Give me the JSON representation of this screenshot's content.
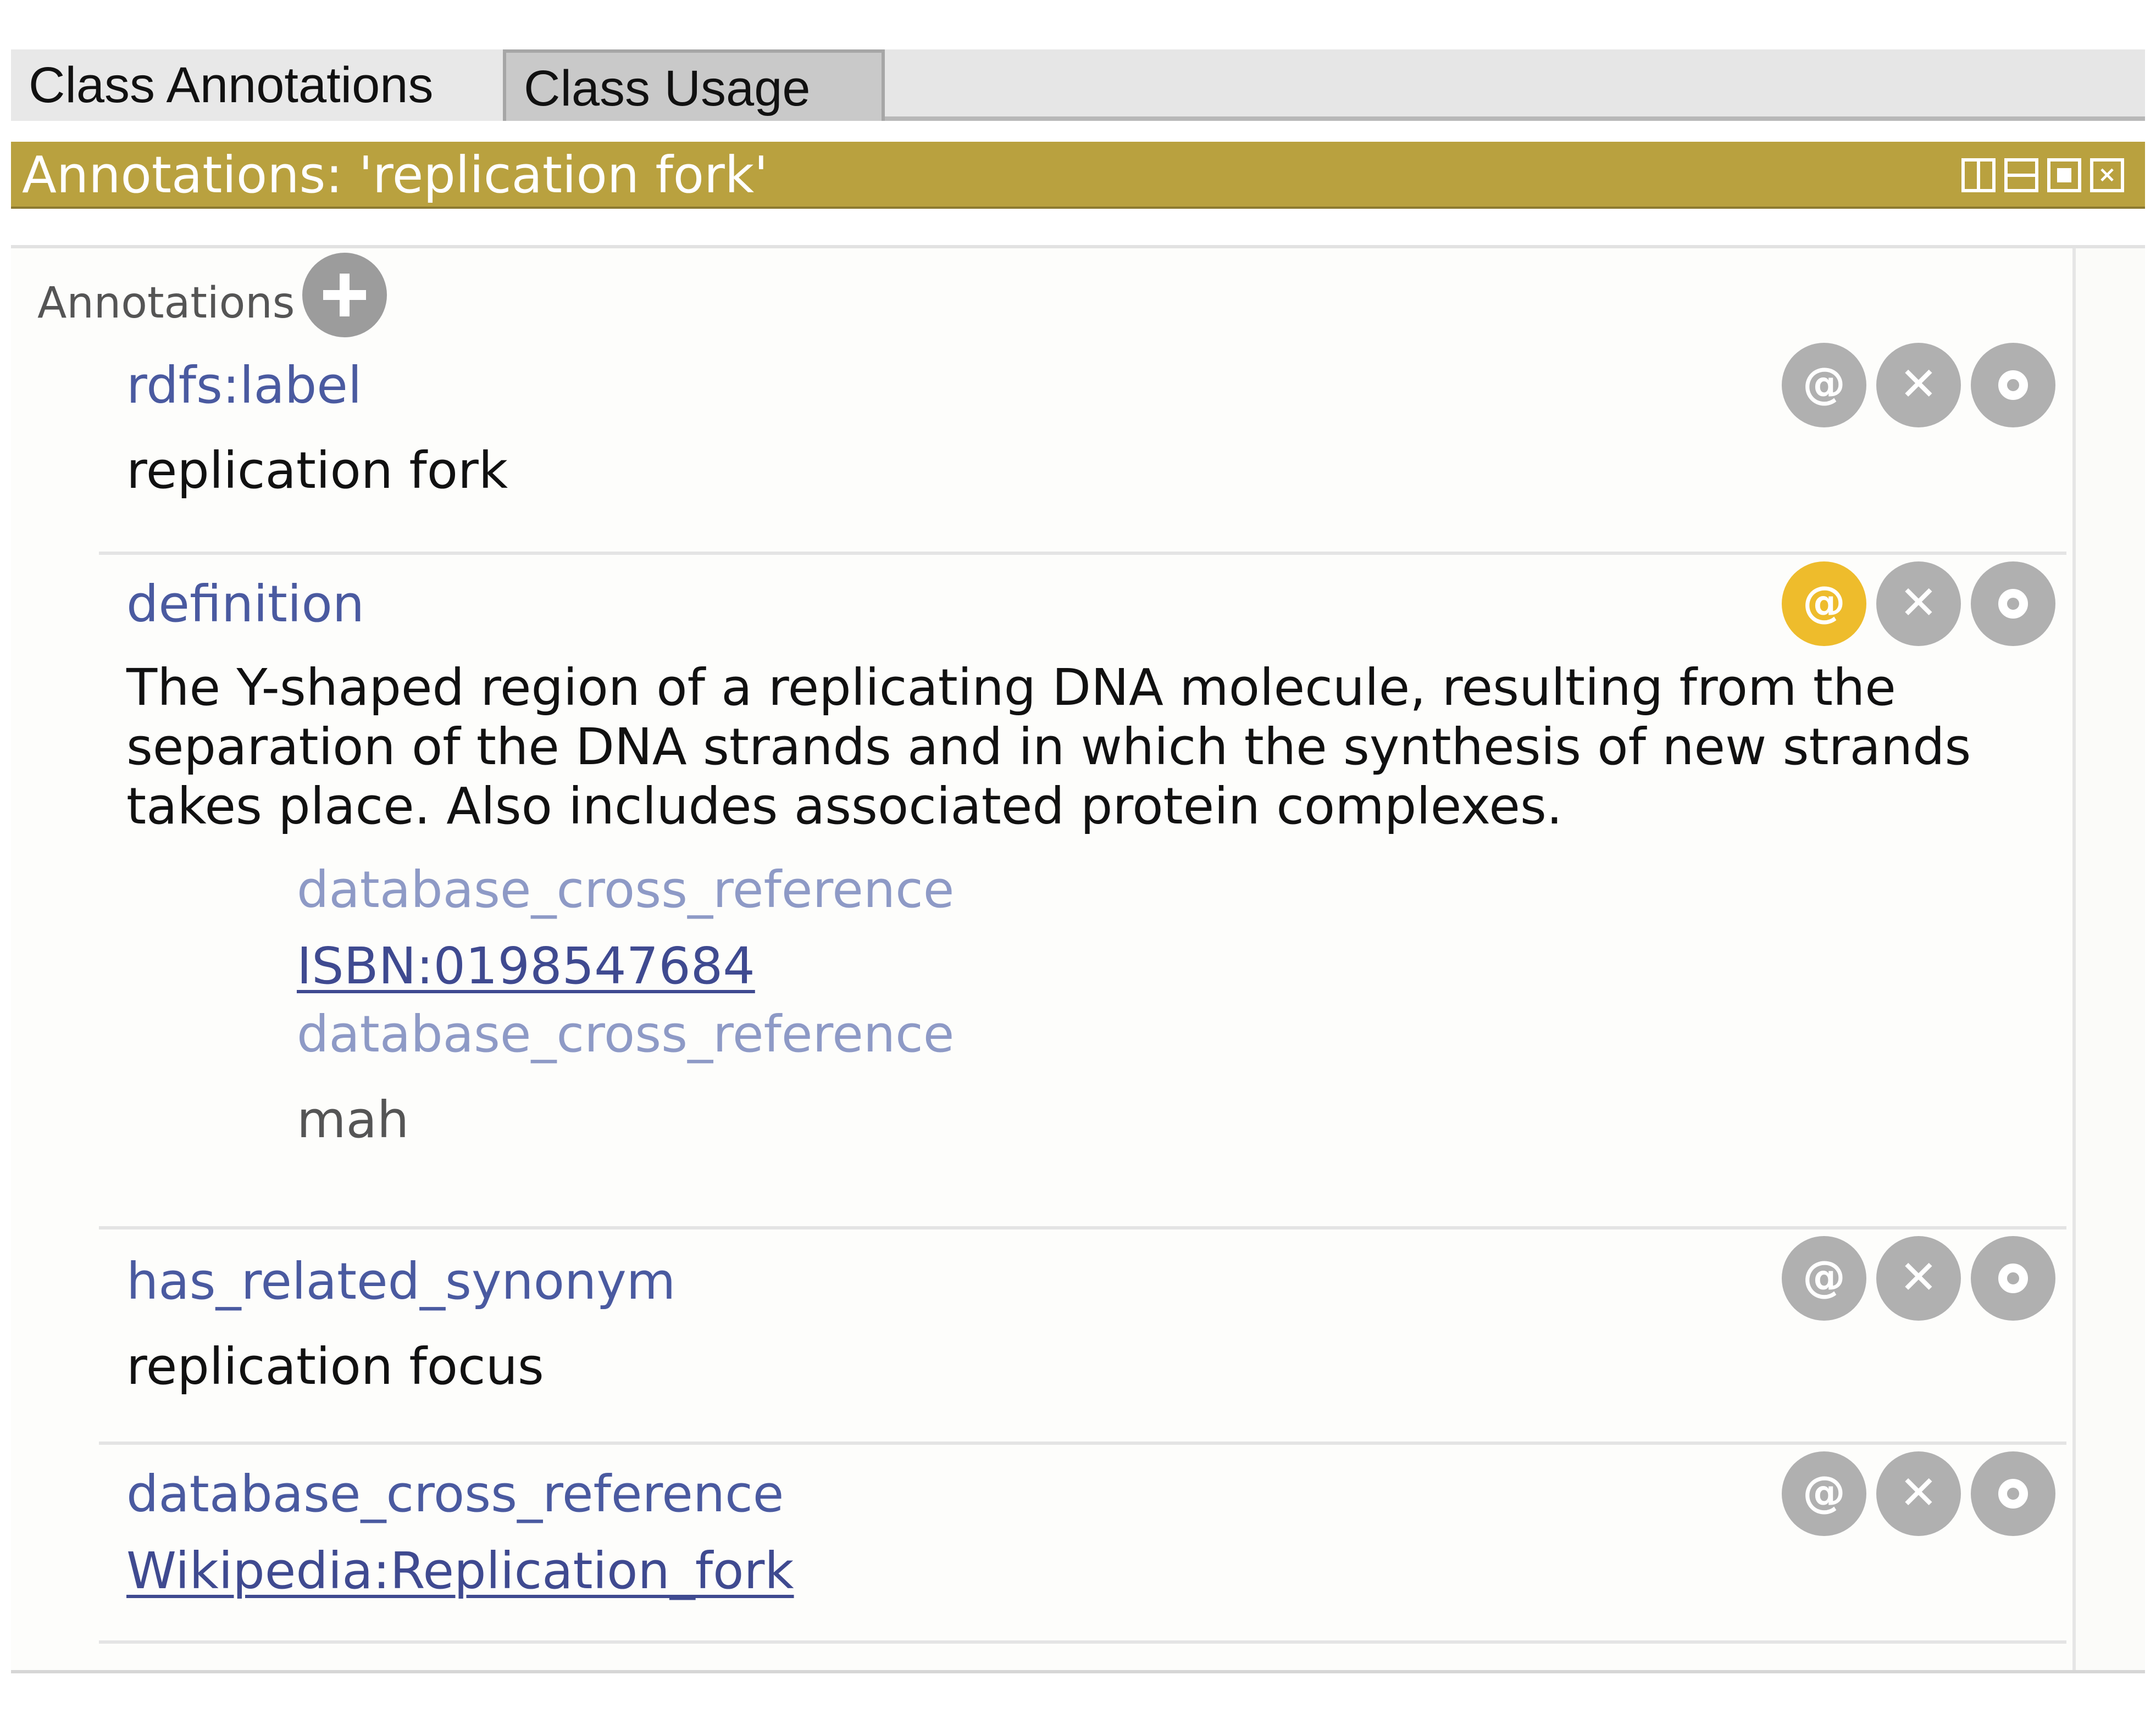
{
  "tabs": [
    {
      "label": "Class Annotations",
      "active": true
    },
    {
      "label": "Class Usage",
      "active": false
    }
  ],
  "header": {
    "title": "Annotations: 'replication fork'",
    "color": "#b9a13f"
  },
  "section": {
    "label": "Annotations"
  },
  "annotations": [
    {
      "property": "rdfs:label",
      "value": "replication fork"
    },
    {
      "property": "definition",
      "value": "The Y-shaped region of a replicating DNA molecule, resulting from the separation of the DNA strands and in which the synthesis of new strands takes place. Also includes associated protein complexes.",
      "has_annotations": true,
      "sub_annotations": [
        {
          "property": "database_cross_reference",
          "value": "ISBN:0198547684",
          "is_link": true
        },
        {
          "property": "database_cross_reference",
          "value": "mah",
          "is_link": false
        }
      ]
    },
    {
      "property": "has_related_synonym",
      "value": "replication focus"
    },
    {
      "property": "database_cross_reference",
      "value": "Wikipedia:Replication_fork",
      "is_link": true
    }
  ],
  "buttons": {
    "annotate": "@",
    "delete": "✕"
  },
  "colors": {
    "property": "#4a5aa0",
    "sub_property": "#8e9ac6",
    "link": "#3f4a90",
    "button_gray": "#b0b0b0",
    "button_active": "#eebc2c"
  }
}
